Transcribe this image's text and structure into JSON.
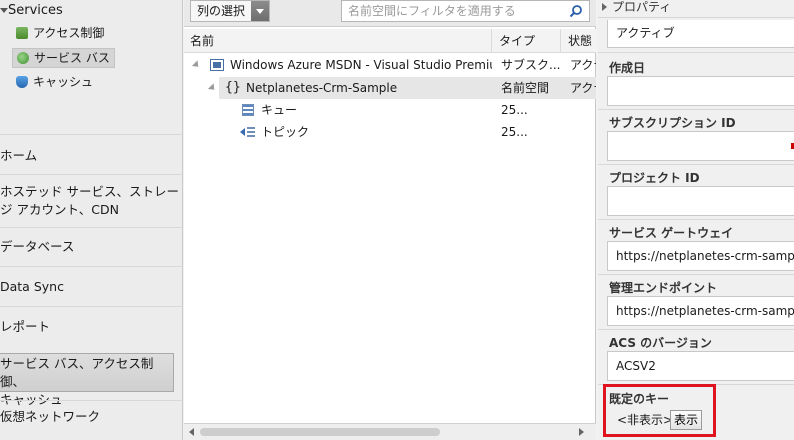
{
  "left_nav": {
    "services_title": "Services",
    "service_items": [
      {
        "label": "アクセス制御"
      },
      {
        "label": "サービス バス"
      },
      {
        "label": "キャッシュ"
      }
    ],
    "nav_items": [
      {
        "label": "ホーム"
      },
      {
        "label_line1": "ホステッド サービス、ストレー",
        "label_line2": "ジ アカウント、CDN"
      },
      {
        "label": "データベース"
      },
      {
        "label": "Data Sync"
      },
      {
        "label": "レポート"
      },
      {
        "label_line1": "サービス バス、アクセス制御、",
        "label_line2": "キャッシュ"
      },
      {
        "label": "仮想ネットワーク"
      }
    ]
  },
  "toolbar": {
    "column_select_label": "列の選択",
    "filter_placeholder": "名前空間にフィルタを適用する"
  },
  "grid": {
    "headers": {
      "name": "名前",
      "type": "タイプ",
      "status": "状態"
    },
    "rows": [
      {
        "name": "Windows Azure MSDN - Visual Studio Premium",
        "type": "サブスク...",
        "status": "アクテ"
      },
      {
        "name": "Netplanetes-Crm-Sample",
        "type": "名前空間",
        "status": "アクテ"
      },
      {
        "name": "キュー",
        "type": "25...",
        "status": ""
      },
      {
        "name": "トピック",
        "type": "25...",
        "status": ""
      }
    ]
  },
  "properties": {
    "title": "プロパティ",
    "status_value": "アクティブ",
    "created_label": "作成日",
    "created_value": "",
    "subscription_id_label": "サブスクリプション ID",
    "subscription_id_value": "",
    "project_id_label": "プロジェクト ID",
    "project_id_value": "",
    "gateway_label": "サービス ゲートウェイ",
    "gateway_value": "https://netplanetes-crm-sample",
    "endpoint_label": "管理エンドポイント",
    "endpoint_value": "https://netplanetes-crm-sample",
    "acs_label": "ACS のバージョン",
    "acs_value": "ACSV2",
    "default_key_label": "既定のキー",
    "default_key_hidden": "<非表示>",
    "show_button": "表示"
  },
  "colors": {
    "highlight": "#e0141e",
    "selection_bg": "#e6e6e6"
  }
}
